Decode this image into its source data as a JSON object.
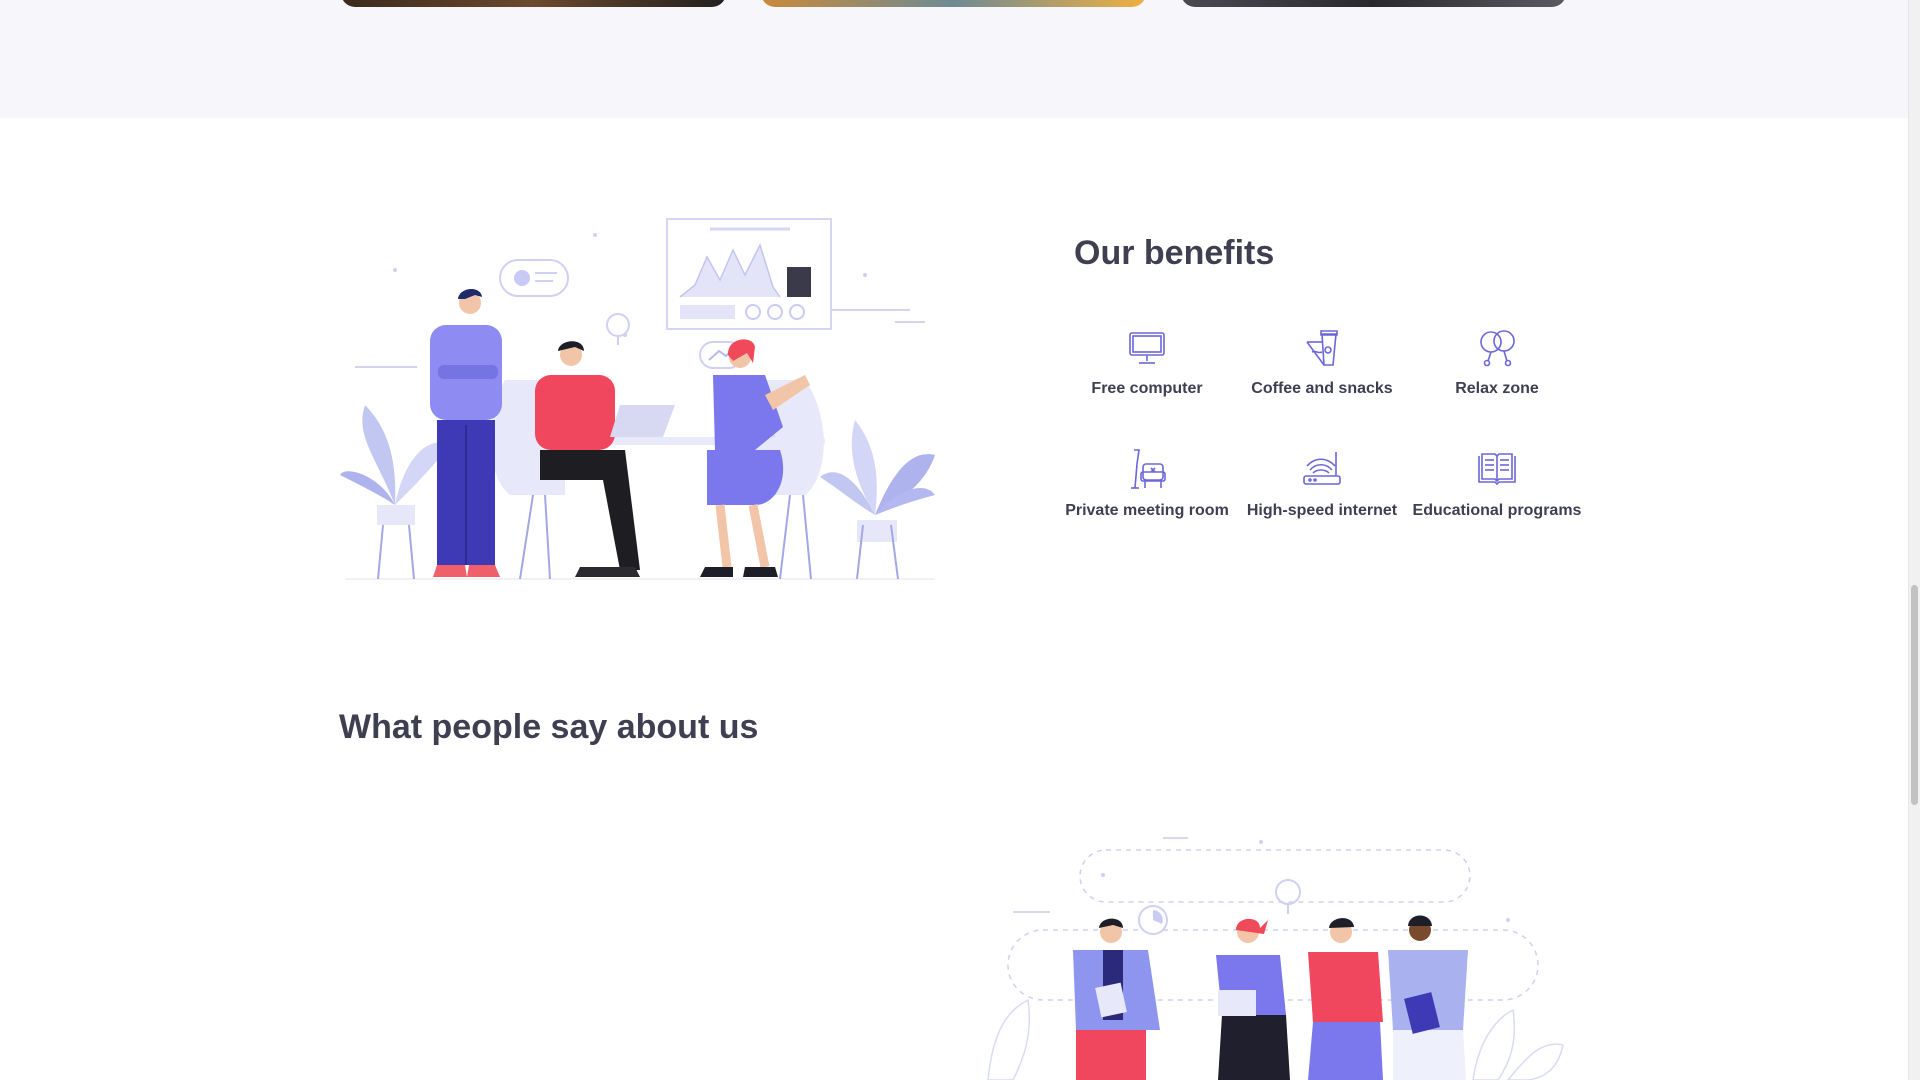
{
  "colors": {
    "accent": "#7f7cf0",
    "icon_stroke": "#6a67d8",
    "heading": "#3f3f52",
    "section_bg": "#f7f7fb"
  },
  "benefits": {
    "title": "Our benefits",
    "items": [
      {
        "icon": "computer-icon",
        "label": "Free computer"
      },
      {
        "icon": "coffee-icon",
        "label": "Coffee and snacks"
      },
      {
        "icon": "balloons-icon",
        "label": "Relax zone"
      },
      {
        "icon": "meeting-chair-icon",
        "label": "Private meeting room"
      },
      {
        "icon": "wifi-router-icon",
        "label": "High-speed internet"
      },
      {
        "icon": "book-icon",
        "label": "Educational programs"
      }
    ]
  },
  "testimonials": {
    "title": "What people say about us"
  }
}
